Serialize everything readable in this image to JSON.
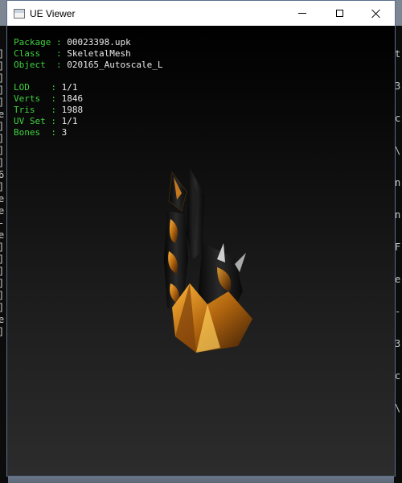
{
  "window": {
    "title": "UE Viewer"
  },
  "controls": {
    "minimize": "minimize-icon",
    "maximize": "maximize-icon",
    "close": "close-icon"
  },
  "info": {
    "group1": [
      {
        "label": "Package",
        "value": "00023398.upk"
      },
      {
        "label": "Class",
        "value": "SkeletalMesh"
      },
      {
        "label": "Object",
        "value": "020165_Autoscale_L"
      }
    ],
    "group2": [
      {
        "label": "LOD",
        "value": "1/1"
      },
      {
        "label": "Verts",
        "value": "1846"
      },
      {
        "label": "Tris",
        "value": "1988"
      },
      {
        "label": "UV Set",
        "value": "1/1"
      },
      {
        "label": "Bones",
        "value": "3"
      }
    ]
  },
  "background_console": {
    "left": [
      "]",
      "]",
      "]",
      "]",
      "]",
      "e",
      "]",
      "]",
      "]",
      "]",
      "6",
      "]",
      "e",
      "e",
      "-",
      "e",
      "]",
      "]",
      "]",
      "]",
      "]",
      "]",
      "e",
      "]"
    ],
    "right": [
      "t",
      "3",
      "c",
      "\\",
      "n",
      "n",
      "F",
      "e",
      "-",
      "3",
      "c",
      "\\"
    ]
  },
  "colors": {
    "label": "#3fd13f",
    "value": "#eaeaea",
    "viewport_top": "#000000",
    "viewport_bottom": "#2c2c2c"
  }
}
